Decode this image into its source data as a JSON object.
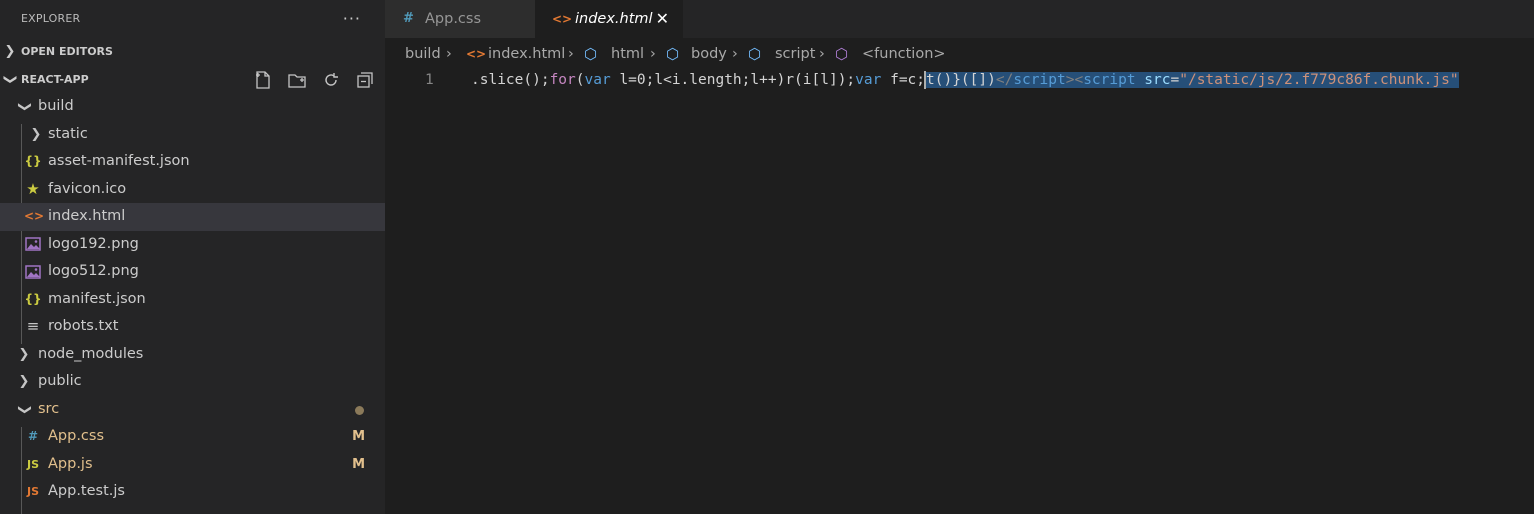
{
  "sidebar": {
    "title": "EXPLORER",
    "more": "···",
    "open_editors": "OPEN EDITORS",
    "project": "REACT-APP",
    "tree": [
      {
        "label": "build",
        "icon": "",
        "badge": ""
      },
      {
        "label": "static",
        "icon": "",
        "badge": ""
      },
      {
        "label": "asset-manifest.json",
        "icon": "{}",
        "badge": ""
      },
      {
        "label": "favicon.ico",
        "icon": "★",
        "badge": ""
      },
      {
        "label": "index.html",
        "icon": "<>",
        "badge": ""
      },
      {
        "label": "logo192.png",
        "icon": "",
        "badge": ""
      },
      {
        "label": "logo512.png",
        "icon": "",
        "badge": ""
      },
      {
        "label": "manifest.json",
        "icon": "{}",
        "badge": ""
      },
      {
        "label": "robots.txt",
        "icon": "≡",
        "badge": ""
      },
      {
        "label": "node_modules",
        "icon": "",
        "badge": ""
      },
      {
        "label": "public",
        "icon": "",
        "badge": ""
      },
      {
        "label": "src",
        "icon": "",
        "badge": ""
      },
      {
        "label": "App.css",
        "icon": "#",
        "badge": "M"
      },
      {
        "label": "App.js",
        "icon": "JS",
        "badge": "M"
      },
      {
        "label": "App.test.js",
        "icon": "JS",
        "badge": ""
      }
    ]
  },
  "tabs": [
    {
      "label": "App.css",
      "icon": "#"
    },
    {
      "label": "index.html",
      "icon": "<>",
      "close": "✕"
    }
  ],
  "breadcrumb": [
    "build",
    "index.html",
    "html",
    "body",
    "script",
    "<function>"
  ],
  "editor": {
    "line_number": "1",
    "code": {
      "t1": ".slice();",
      "t2": "for",
      "t3": "(",
      "t4": "var",
      "t5": " l=0;l<i.length;l++)r(i[l]);",
      "t6": "var",
      "t7": " f=c;",
      "s1": "t()}([])",
      "s2": "</",
      "s3": "script",
      "s4": "><",
      "s5": "script",
      "s6": " src",
      "s7": "=",
      "s8": "\"/static/js/2.f779c86f.chunk.js\""
    }
  },
  "colors": {
    "sidebar_bg": "#252526",
    "editor_bg": "#1e1e1e",
    "selection": "#264f78",
    "modified": "#e2c08d",
    "html_icon": "#e37933",
    "json_icon": "#cbcb41",
    "css_icon": "#519aba",
    "js_icon": "#cbcb41",
    "image_icon": "#a074c4"
  }
}
